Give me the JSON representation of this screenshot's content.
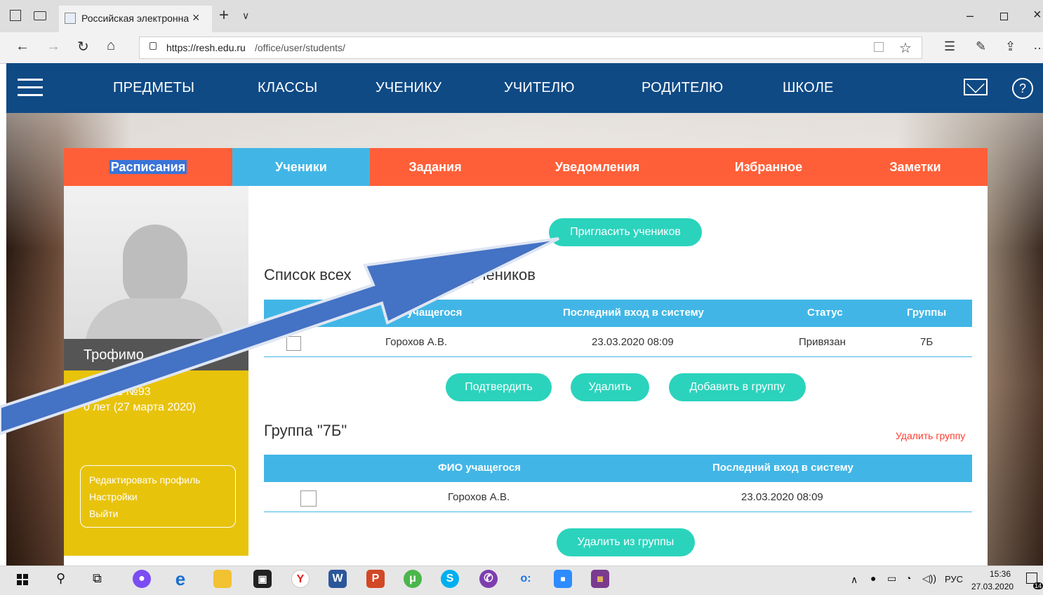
{
  "browser": {
    "tab_title": "Российская электронна",
    "url_host": "https://resh.edu.ru",
    "url_path": "/office/user/students/"
  },
  "nav": {
    "items": [
      "ПРЕДМЕТЫ",
      "КЛАССЫ",
      "УЧЕНИКУ",
      "УЧИТЕЛЮ",
      "РОДИТЕЛЮ",
      "ШКОЛЕ"
    ]
  },
  "tabs": {
    "schedule": "Расписания",
    "students": "Ученики",
    "tasks": "Задания",
    "notifications": "Уведомления",
    "favorites": "Избранное",
    "notes": "Заметки"
  },
  "sidebar": {
    "name": "Трофимо",
    "school": "СШ №93",
    "age": "0 лет (27 марта 2020)",
    "menu": [
      "Редактировать профиль",
      "Настройки",
      "Выйти"
    ]
  },
  "main": {
    "invite_button": "Пригласить учеников",
    "all_title_left": "Список всех",
    "all_title_right": "учеников",
    "all_table": {
      "headers": [
        "О учащегося",
        "Последний вход в систему",
        "Статус",
        "Группы"
      ],
      "rows": [
        {
          "name": "Горохов А.В.",
          "last_login": "23.03.2020 08:09",
          "status": "Привязан",
          "group": "7Б"
        }
      ]
    },
    "confirm_button": "Подтвердить",
    "delete_button": "Удалить",
    "add_group_button": "Добавить в группу",
    "group_title": "Группа \"7Б\"",
    "delete_group_link": "Удалить группу",
    "group_table": {
      "headers": [
        "ФИО учащегося",
        "Последний вход в систему"
      ],
      "rows": [
        {
          "name": "Горохов А.В.",
          "last_login": "23.03.2020 08:09"
        }
      ]
    },
    "remove_from_group_button": "Удалить из группы"
  },
  "taskbar": {
    "lang": "РУС",
    "time": "15:36",
    "date": "27.03.2020",
    "notifications": "14"
  },
  "colors": {
    "accent_orange": "#ff5f38",
    "accent_blue": "#41b6e6",
    "button_teal": "#2bd3bc",
    "nav_blue": "#0f4a85",
    "sidebar_yellow": "#e8c30c",
    "arrow_blue": "#4472c4"
  }
}
